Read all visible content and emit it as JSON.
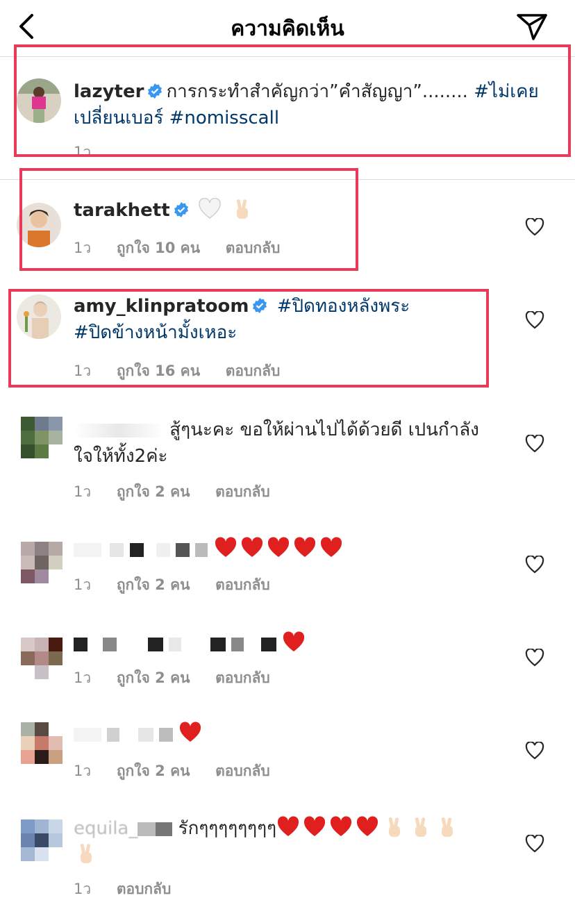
{
  "header": {
    "title": "ความคิดเห็น"
  },
  "caption": {
    "username": "lazyter",
    "text_line1": "การกระทำสำคัญกว่า”คำสัญญา”........",
    "tag1": "#ไม่เคย",
    "tag1_cont": "เปลี่ยนเบอร์",
    "tag2": "#nomisscall",
    "time": "1ว"
  },
  "comments": [
    {
      "username": "tarakhett",
      "time": "1ว",
      "likes": "ถูกใจ 10 คน",
      "reply": "ตอบกลับ"
    },
    {
      "username": "amy_klinpratoom",
      "tag1": "#ปิดทองหลังพระ",
      "tag2": "#ปิดข้างหน้ามั้งเหอะ",
      "time": "1ว",
      "likes": "ถูกใจ 16 คน",
      "reply": "ตอบกลับ"
    },
    {
      "text_line1": "สู้ๆนะคะ ขอให้ผ่านไปได้ด้วยดี เปนกำลัง",
      "text_line2": "ใจให้ทั้ง2ค่ะ",
      "time": "1ว",
      "likes": "ถูกใจ 2 คน",
      "reply": "ตอบกลับ"
    },
    {
      "time": "1ว",
      "likes": "ถูกใจ 2 คน",
      "reply": "ตอบกลับ"
    },
    {
      "time": "1ว",
      "likes": "ถูกใจ 2 คน",
      "reply": "ตอบกลับ"
    },
    {
      "time": "1ว",
      "likes": "ถูกใจ 2 คน",
      "reply": "ตอบกลับ"
    },
    {
      "username_partial": "equila_",
      "text": "รักๆๆๆๆๆๆๆๆ",
      "time": "1ว",
      "reply": "ตอบกลับ"
    }
  ],
  "icons": {
    "back": "chevron-left-icon",
    "share": "paper-plane-icon",
    "verified": "verified-badge-icon",
    "like": "heart-outline-icon"
  },
  "colors": {
    "hashtag": "#00376b",
    "verified": "#3897f0",
    "highlight": "#e83a59",
    "meta": "#8e8e8e"
  }
}
